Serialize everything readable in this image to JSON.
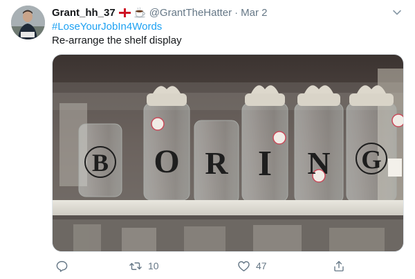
{
  "tweet": {
    "display_name": "Grant_hh_37",
    "emojis": [
      "england-flag",
      "hot-beverage"
    ],
    "handle": "@GrantTheHatter",
    "separator": "·",
    "date": "Mar 2",
    "hashtag": "#LoseYourJobIn4Words",
    "text": "Re-arrange the shelf display"
  },
  "media": {
    "jar_letters": [
      "B",
      "O",
      "R",
      "I",
      "N",
      "G"
    ]
  },
  "actions": {
    "reply_icon": "reply-icon",
    "retweet_count": "10",
    "like_count": "47",
    "share_icon": "share-icon"
  },
  "colors": {
    "link": "#1da1f2",
    "secondary_text": "#657786",
    "primary_text": "#14171a",
    "border": "#e1e8ed"
  }
}
